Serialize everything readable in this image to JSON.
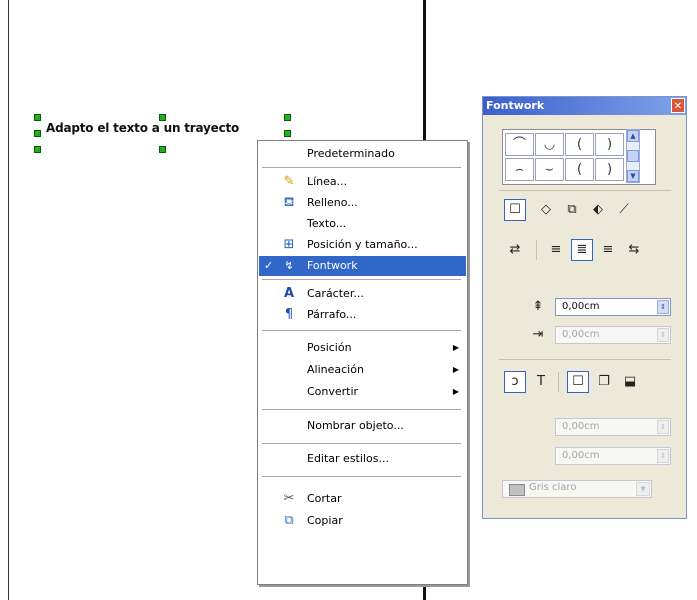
{
  "document": {
    "text": "Adapto el texto a un trayecto"
  },
  "context_menu": {
    "items": [
      {
        "label": "Predeterminado",
        "icon": ""
      },
      {
        "label": "Línea...",
        "icon": "line-icon"
      },
      {
        "label": "Relleno...",
        "icon": "fill-bucket-icon"
      },
      {
        "label": "Texto...",
        "icon": ""
      },
      {
        "label": "Posición y tamaño...",
        "icon": "position-size-icon"
      },
      {
        "label": "Fontwork",
        "icon": "fontwork-icon",
        "checked": true,
        "check_mark": "✓"
      },
      {
        "label": "Carácter...",
        "icon": "character-icon"
      },
      {
        "label": "Párrafo...",
        "icon": "paragraph-icon"
      },
      {
        "label": "Posición",
        "submenu": true
      },
      {
        "label": "Alineación",
        "submenu": true
      },
      {
        "label": "Convertir",
        "submenu": true
      },
      {
        "label": "Nombrar objeto..."
      },
      {
        "label": "Editar estilos..."
      },
      {
        "label": "Cortar",
        "icon": "scissors-icon"
      },
      {
        "label": "Copiar",
        "icon": "copy-icon"
      }
    ],
    "submenu_arrow": "▶"
  },
  "fontwork": {
    "title": "Fontwork",
    "close_glyph": "✕",
    "shapes": [
      "⌒",
      "◡",
      "(",
      ")",
      "⌢",
      "⌣",
      "(",
      ")"
    ],
    "scroll_up": "▲",
    "scroll_down": "▼",
    "style_icons": [
      "☐",
      "◇",
      "⧉",
      "⬖",
      "⟋"
    ],
    "align_icons": [
      "⇄",
      "≡",
      "≣",
      "≡",
      "⇆"
    ],
    "distance_label": "⇞",
    "distance_value": "0,00cm",
    "indent_label": "⇥",
    "indent_value": "0,00cm",
    "contour_icons": [
      "ↄ",
      "T",
      "☐",
      "❐",
      "⬓"
    ],
    "shadow_x_value": "0,00cm",
    "shadow_y_value": "0,00cm",
    "color_value": "Gris claro",
    "spin_glyph": "⇕",
    "dropdown_glyph": "▼",
    "colors": {
      "title_start": "#3a5fcd",
      "title_end": "#7fa3e8",
      "swatch": "#c0c0c0",
      "selection": "#3067c8"
    }
  }
}
